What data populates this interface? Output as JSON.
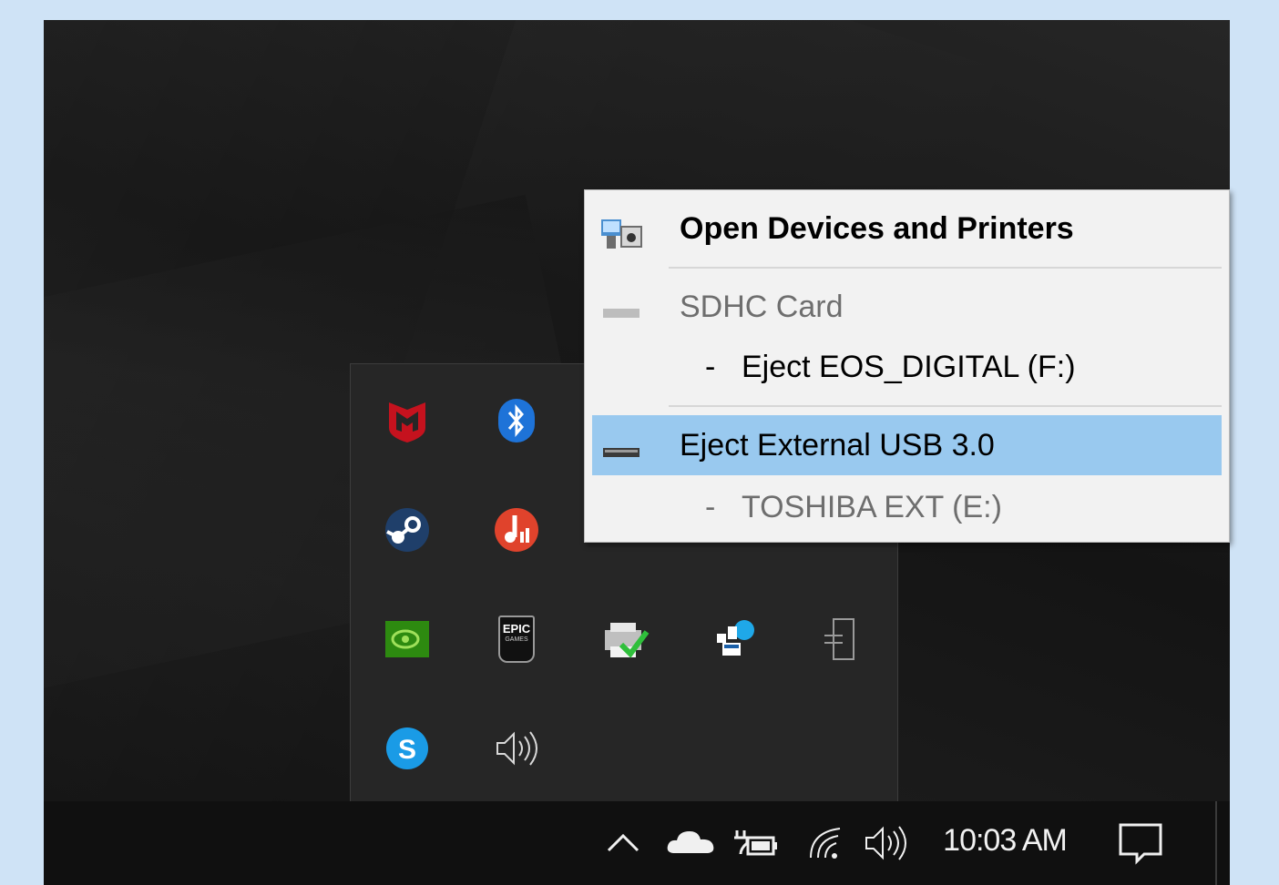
{
  "context_menu": {
    "items": [
      {
        "label": "Open Devices and Printers",
        "icon": "devices-printers-icon",
        "bold": true
      },
      {
        "label": "SDHC Card",
        "icon": "sd-card-drive-icon",
        "disabled": true
      },
      {
        "label": "-",
        "sub_label": "Eject EOS_DIGITAL (F:)"
      },
      {
        "label": "Eject External USB 3.0",
        "icon": "usb-drive-icon",
        "highlighted": true
      },
      {
        "label": "-",
        "sub_label": "TOSHIBA EXT (E:)",
        "disabled": true
      }
    ]
  },
  "tray_overflow": {
    "icons": [
      "mcafee-icon",
      "bluetooth-icon",
      "steam-icon",
      "music-app-icon",
      "nvidia-icon",
      "epic-games-icon",
      "printer-check-icon",
      "network-people-icon",
      "eject-device-icon",
      "skype-icon",
      "speaker-icon"
    ],
    "epic_text": "EPIC",
    "epic_sub": "GAMES"
  },
  "taskbar": {
    "clock": "10:03 AM",
    "icons": [
      "show-hidden-icons-chevron",
      "onedrive-icon",
      "power-battery-icon",
      "wifi-icon",
      "volume-icon",
      "action-center-icon"
    ]
  },
  "colors": {
    "menu_bg": "#f2f2f2",
    "highlight": "#99c9ef",
    "taskbar_bg": "#101010",
    "overflow_bg": "#262626"
  }
}
